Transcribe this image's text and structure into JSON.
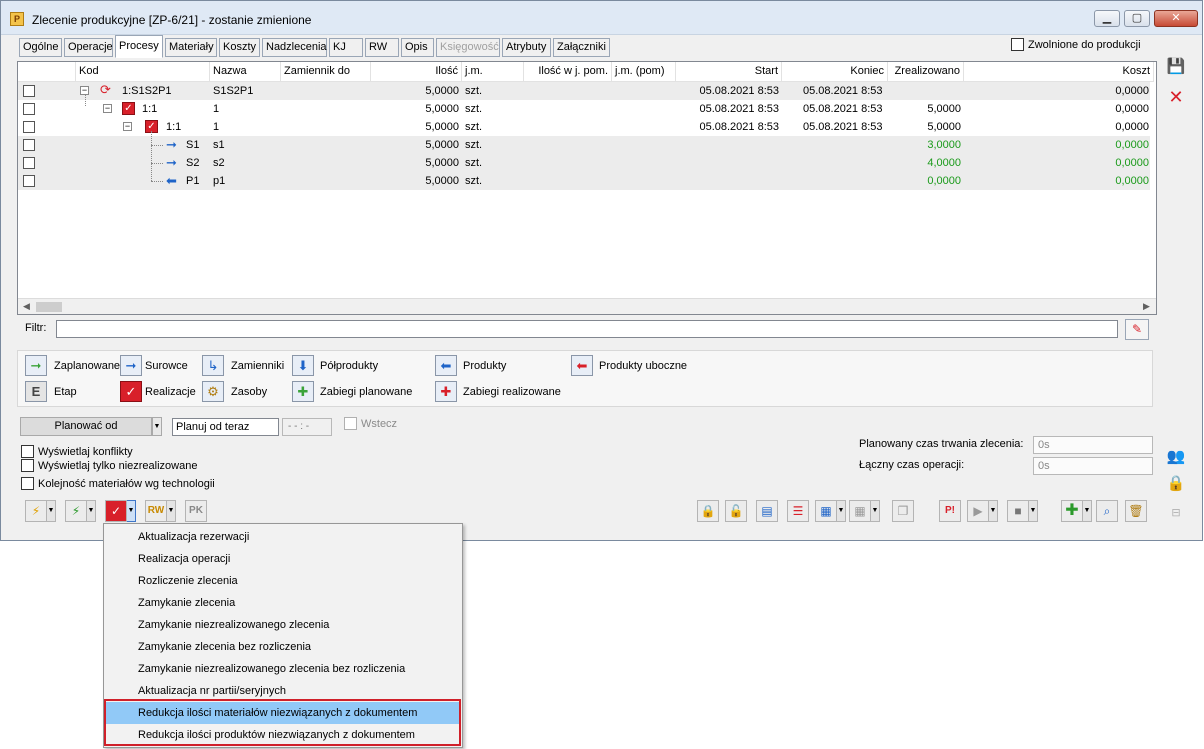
{
  "window": {
    "title": "Zlecenie produkcyjne  [ZP-6/21] - zostanie zmienione",
    "app_icon": "P",
    "min_icon": "minimize-icon",
    "max_icon": "maximize-icon",
    "close_icon": "close-icon"
  },
  "tabs": [
    "Ogólne",
    "Operacje",
    "Procesy",
    "Materiały",
    "Koszty",
    "Nadzlecenia",
    "KJ",
    "RW",
    "Opis",
    "Księgowość",
    "Atrybuty",
    "Załączniki"
  ],
  "active_tab": "Procesy",
  "released_label": "Zwolnione do produkcji",
  "grid": {
    "headers": [
      "Kod",
      "Nazwa",
      "Zamiennik do",
      "Ilość",
      "j.m.",
      "Ilość w j. pom.",
      "j.m. (pom)",
      "Start",
      "Koniec",
      "Zrealizowano",
      "Koszt"
    ],
    "rows": [
      {
        "kod": "1:S1S2P1",
        "nazwa": "S1S2P1",
        "ilosc": "5,0000",
        "jm": "szt.",
        "start": "05.08.2021 8:53",
        "koniec": "05.08.2021 8:53",
        "zreal": "",
        "koszt": "0,0000"
      },
      {
        "kod": "1:1",
        "nazwa": "1",
        "ilosc": "5,0000",
        "jm": "szt.",
        "start": "05.08.2021 8:53",
        "koniec": "05.08.2021 8:53",
        "zreal": "5,0000",
        "koszt": "0,0000"
      },
      {
        "kod": "1:1",
        "nazwa": "1",
        "ilosc": "5,0000",
        "jm": "szt.",
        "start": "05.08.2021 8:53",
        "koniec": "05.08.2021 8:53",
        "zreal": "5,0000",
        "koszt": "0,0000"
      },
      {
        "kod": "S1",
        "nazwa": "s1",
        "ilosc": "5,0000",
        "jm": "szt.",
        "start": "",
        "koniec": "",
        "zreal": "3,0000",
        "koszt": "0,0000"
      },
      {
        "kod": "S2",
        "nazwa": "s2",
        "ilosc": "5,0000",
        "jm": "szt.",
        "start": "",
        "koniec": "",
        "zreal": "4,0000",
        "koszt": "0,0000"
      },
      {
        "kod": "P1",
        "nazwa": "p1",
        "ilosc": "5,0000",
        "jm": "szt.",
        "start": "",
        "koniec": "",
        "zreal": "0,0000",
        "koszt": "0,0000"
      }
    ]
  },
  "filter": {
    "label": "Filtr:",
    "value": ""
  },
  "legend": {
    "zaplanowane": "Zaplanowane",
    "surowce": "Surowce",
    "zamienniki": "Zamienniki",
    "polprodukty": "Półprodukty",
    "produkty": "Produkty",
    "produkty_uboczne": "Produkty uboczne",
    "etap": "Etap",
    "etap_icon": "E",
    "realizacje": "Realizacje",
    "zasoby": "Zasoby",
    "zabiegi_planowane": "Zabiegi planowane",
    "zabiegi_realizowane": "Zabiegi realizowane"
  },
  "planning": {
    "button": "Planować od",
    "input": "Planuj od teraz",
    "time": "- - : -",
    "wstecz": "Wstecz"
  },
  "options": [
    "Wyświetlaj konflikty",
    "Wyświetlaj tylko niezrealizowane",
    "Kolejność materiałów wg technologii"
  ],
  "info": {
    "planned_label": "Planowany czas trwania zlecenia:",
    "planned_value": "0s",
    "total_label": "Łączny czas operacji:",
    "total_value": "0s"
  },
  "toolbar": {
    "rw_label": "RW",
    "pk_label": "PK",
    "p_label": "P!"
  },
  "menu": {
    "items": [
      "Aktualizacja rezerwacji",
      "Realizacja operacji",
      "Rozliczenie zlecenia",
      "Zamykanie zlecenia",
      "Zamykanie niezrealizowanego zlecenia",
      "Zamykanie zlecenia bez rozliczenia",
      "Zamykanie niezrealizowanego zlecenia bez rozliczenia",
      "Aktualizacja nr partii/seryjnych",
      "Redukcja ilości materiałów niezwiązanych z dokumentem",
      "Redukcja ilości produktów niezwiązanych z dokumentem"
    ],
    "hover_index": 8
  },
  "colors": {
    "accent": "#91c9f7",
    "highlight": "#d0202a",
    "positive": "#1a9a1a",
    "arrow": "#1f64c8"
  }
}
